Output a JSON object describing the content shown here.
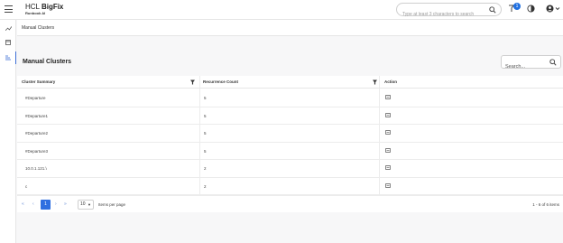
{
  "header": {
    "brand_prefix": "HCL ",
    "brand_name": "BigFix",
    "brand_sub": "Runbook AI",
    "search_placeholder": "Type at least 3 characters to search",
    "notification_count": "1"
  },
  "breadcrumb": "Manual Clusters",
  "page": {
    "title": "Manual Clusters",
    "search_placeholder": "Search..."
  },
  "table": {
    "columns": [
      "Cluster Summary",
      "Recurrence Count",
      "Action"
    ],
    "rows": [
      {
        "summary": "#Departure",
        "count": "5"
      },
      {
        "summary": "#Departure1",
        "count": "5"
      },
      {
        "summary": "#Departure2",
        "count": "5"
      },
      {
        "summary": "#Departure3",
        "count": "5"
      },
      {
        "summary": "10.0.1.121.\\",
        "count": "2"
      },
      {
        "summary": "c",
        "count": "2"
      }
    ]
  },
  "pagination": {
    "current_page": "1",
    "page_size": "10",
    "items_per_page_label": "Items per page",
    "range_text": "1 - 6 of 6 items"
  },
  "colors": {
    "accent": "#2f6fe0",
    "sidebar_active": "#3d6fd6"
  }
}
